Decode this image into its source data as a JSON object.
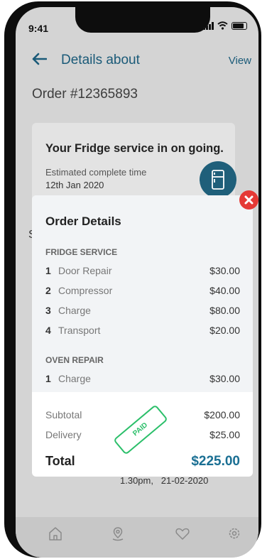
{
  "status_bar": {
    "time": "9:41"
  },
  "header": {
    "title": "Details about",
    "view_label": "View"
  },
  "order": {
    "number": "Order #12365893"
  },
  "status_card": {
    "heading": "Your Fridge service in on going.",
    "estimated_label": "Estimated complete time",
    "estimated_date": "12th Jan 2020"
  },
  "background": {
    "partial_letter": "S",
    "date_time": "1.30pm,   21-02-2020"
  },
  "order_details": {
    "title": "Order Details",
    "sections": [
      {
        "name": "FRIDGE SERVICE",
        "items": [
          {
            "num": "1",
            "name": "Door Repair",
            "price": "$30.00"
          },
          {
            "num": "2",
            "name": "Compressor",
            "price": "$40.00"
          },
          {
            "num": "3",
            "name": "Charge",
            "price": "$80.00"
          },
          {
            "num": "4",
            "name": "Transport",
            "price": "$20.00"
          }
        ]
      },
      {
        "name": "OVEN REPAIR",
        "items": [
          {
            "num": "1",
            "name": "Charge",
            "price": "$30.00"
          }
        ]
      }
    ],
    "subtotal_label": "Subtotal",
    "subtotal": "$200.00",
    "delivery_label": "Delivery",
    "delivery": "$25.00",
    "total_label": "Total",
    "total": "$225.00",
    "stamp": "PAID"
  },
  "tabbar": {
    "icons": [
      "home-icon",
      "location-icon",
      "heart-icon",
      "settings-icon"
    ]
  },
  "colors": {
    "accent": "#1a6f93",
    "close": "#e53935",
    "paid_stamp": "#2bbf6a"
  }
}
